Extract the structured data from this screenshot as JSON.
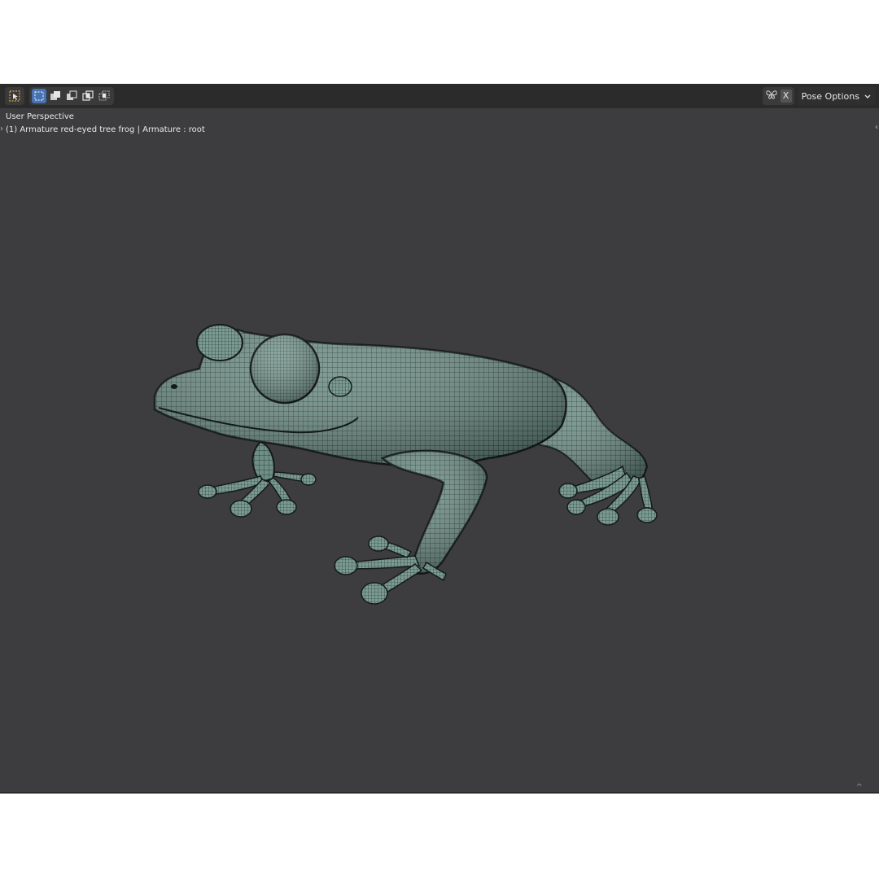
{
  "viewport": {
    "info_line1": "User Perspective",
    "info_line2": "(1) Armature red-eyed tree frog | Armature : root",
    "background_color": "#3d3c3f"
  },
  "header": {
    "select_tools": [
      {
        "icon": "select-box-icon",
        "active": false
      },
      {
        "icon": "select-new-icon",
        "active": true
      },
      {
        "icon": "select-extend-icon",
        "active": false
      },
      {
        "icon": "select-subtract-icon",
        "active": false
      },
      {
        "icon": "select-difference-icon",
        "active": false
      },
      {
        "icon": "select-intersect-icon",
        "active": false
      }
    ],
    "x_mirror_label": "X",
    "pose_options_label": "Pose Options"
  },
  "model": {
    "name": "red-eyed tree frog",
    "mesh_color": "#6f9088",
    "wire_color": "#1c2422"
  }
}
